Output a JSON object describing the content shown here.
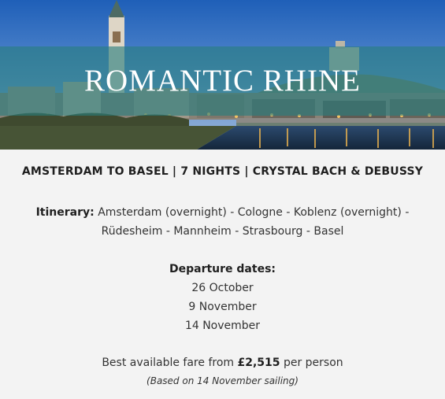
{
  "hero": {
    "title": "ROMANTIC RHINE"
  },
  "route": "AMSTERDAM TO BASEL | 7 NIGHTS | CRYSTAL BACH & DEBUSSY",
  "itinerary": {
    "label": "Itinerary:",
    "line1": "Amsterdam (overnight) - Cologne - Koblenz (overnight) -",
    "line2": "Rüdesheim - Mannheim - Strasbourg - Basel"
  },
  "departures": {
    "heading": "Departure dates:",
    "dates": [
      "26 October",
      "9 November",
      "14 November"
    ]
  },
  "fare": {
    "prefix": "Best available fare from ",
    "price": "£2,515",
    "suffix": " per person",
    "note": "(Based on 14 November sailing)"
  }
}
